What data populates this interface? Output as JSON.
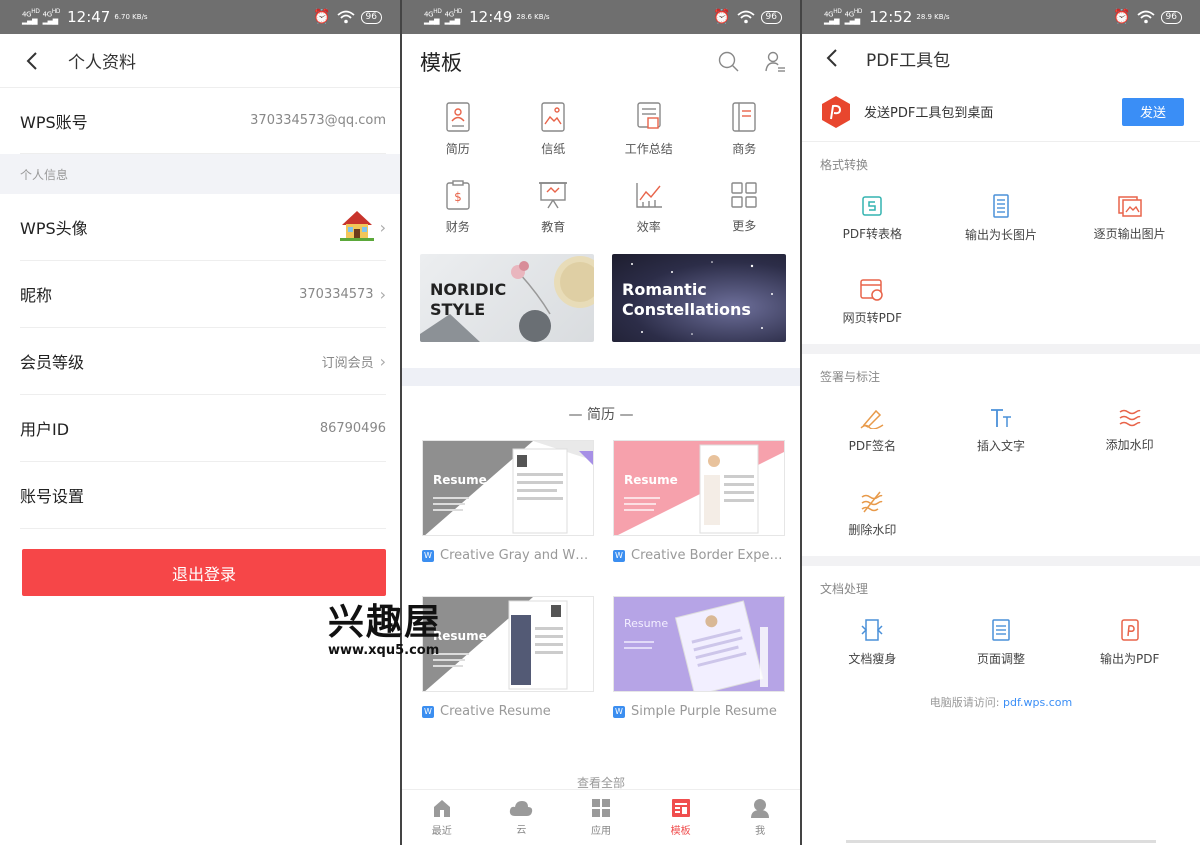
{
  "colors": {
    "accent_red": "#f64648",
    "accent_blue": "#3a8ef6",
    "status_bar": "#6f6f6f"
  },
  "screen1": {
    "status": {
      "signal": "4G",
      "time": "12:47",
      "speed": "6.70 KB/s",
      "battery": "96"
    },
    "header": {
      "title": "个人资料"
    },
    "wps_account": {
      "label": "WPS账号",
      "value": "370334573@qq.com"
    },
    "section_personal": "个人信息",
    "avatar_row": {
      "label": "WPS头像"
    },
    "nickname": {
      "label": "昵称",
      "value": "370334573"
    },
    "member_level": {
      "label": "会员等级",
      "value": "订阅会员"
    },
    "user_id": {
      "label": "用户ID",
      "value": "86790496"
    },
    "account_settings": {
      "label": "账号设置"
    },
    "logout_label": "退出登录"
  },
  "watermark": {
    "name": "兴趣屋",
    "url": "www.xqu5.com"
  },
  "screen2": {
    "status": {
      "signal": "4G",
      "time": "12:49",
      "speed": "28.6 KB/s",
      "battery": "96"
    },
    "header": {
      "title": "模板"
    },
    "categories": [
      {
        "label": "简历",
        "icon": "resume-icon"
      },
      {
        "label": "信纸",
        "icon": "letter-icon"
      },
      {
        "label": "工作总结",
        "icon": "work-summary-icon"
      },
      {
        "label": "商务",
        "icon": "business-icon"
      },
      {
        "label": "财务",
        "icon": "finance-icon"
      },
      {
        "label": "教育",
        "icon": "education-icon"
      },
      {
        "label": "效率",
        "icon": "efficiency-icon"
      },
      {
        "label": "更多",
        "icon": "more-icon"
      }
    ],
    "banners": [
      {
        "text_line1": "NORIDIC",
        "text_line2": "STYLE"
      },
      {
        "text_line1": "Romantic",
        "text_line2": "Constellations"
      }
    ],
    "section_title": "— 简历 —",
    "templates": [
      {
        "title": "Creative Gray and W…",
        "thumb_label": "Resume"
      },
      {
        "title": "Creative Border Expe…",
        "thumb_label": "Resume"
      },
      {
        "title": "Creative  Resume",
        "thumb_label": "Resume"
      },
      {
        "title": "Simple Purple Resume",
        "thumb_label": "Resume"
      }
    ],
    "view_all": "查看全部",
    "tabs": [
      {
        "label": "最近",
        "icon": "home-icon"
      },
      {
        "label": "云",
        "icon": "cloud-icon"
      },
      {
        "label": "应用",
        "icon": "apps-icon"
      },
      {
        "label": "模板",
        "icon": "template-icon",
        "active": true
      },
      {
        "label": "我",
        "icon": "profile-icon"
      }
    ]
  },
  "screen3": {
    "status": {
      "signal": "4G",
      "time": "12:52",
      "speed": "28.9 KB/s",
      "battery": "96"
    },
    "header": {
      "title": "PDF工具包"
    },
    "promo": {
      "text": "发送PDF工具包到桌面",
      "button": "发送"
    },
    "groups": [
      {
        "title": "格式转换",
        "tools": [
          "PDF转表格",
          "输出为长图片",
          "逐页输出图片",
          "网页转PDF"
        ]
      },
      {
        "title": "签署与标注",
        "tools": [
          "PDF签名",
          "插入文字",
          "添加水印",
          "删除水印"
        ]
      },
      {
        "title": "文档处理",
        "tools": [
          "文档瘦身",
          "页面调整",
          "输出为PDF"
        ]
      }
    ],
    "footer": {
      "text": "电脑版请访问:",
      "link": "pdf.wps.com"
    }
  }
}
